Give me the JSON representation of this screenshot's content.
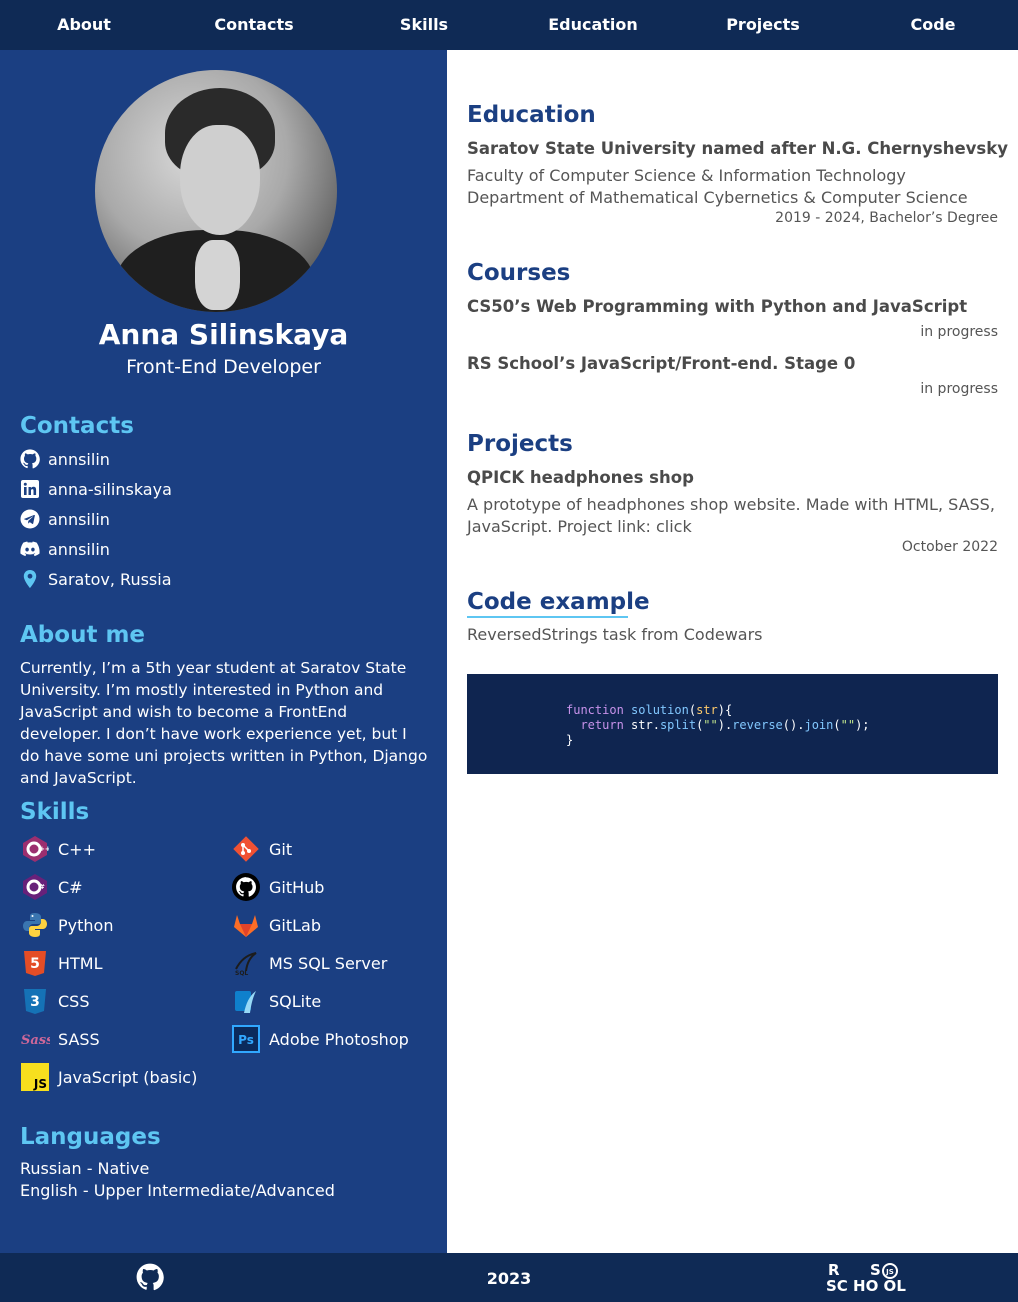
{
  "nav": {
    "items": [
      "About",
      "Contacts",
      "Skills",
      "Education",
      "Projects",
      "Code"
    ]
  },
  "profile": {
    "name": "Anna Silinskaya",
    "role": "Front-End Developer"
  },
  "contacts": {
    "heading": "Contacts",
    "items": [
      {
        "icon": "github-icon",
        "text": "annsilin"
      },
      {
        "icon": "linkedin-icon",
        "text": "anna-silinskaya"
      },
      {
        "icon": "telegram-icon",
        "text": "annsilin"
      },
      {
        "icon": "discord-icon",
        "text": "annsilin"
      },
      {
        "icon": "location-icon",
        "text": "Saratov, Russia"
      }
    ]
  },
  "about": {
    "heading": "About me",
    "text": "Currently, I’m a 5th year student at Saratov State University. I’m mostly interested in Python and JavaScript and wish to become a FrontEnd developer. I don’t have work experience yet, but I do have some uni projects written in Python, Django and JavaScript."
  },
  "skills": {
    "heading": "Skills",
    "items": [
      {
        "icon": "cpp-icon",
        "name": "C++"
      },
      {
        "icon": "git-icon",
        "name": "Git"
      },
      {
        "icon": "csharp-icon",
        "name": "C#"
      },
      {
        "icon": "github-icon",
        "name": "GitHub"
      },
      {
        "icon": "python-icon",
        "name": "Python"
      },
      {
        "icon": "gitlab-icon",
        "name": "GitLab"
      },
      {
        "icon": "html-icon",
        "name": "HTML"
      },
      {
        "icon": "mssql-icon",
        "name": "MS SQL Server"
      },
      {
        "icon": "css-icon",
        "name": "CSS"
      },
      {
        "icon": "sqlite-icon",
        "name": "SQLite"
      },
      {
        "icon": "sass-icon",
        "name": "SASS"
      },
      {
        "icon": "photoshop-icon",
        "name": "Adobe Photoshop"
      },
      {
        "icon": "javascript-icon",
        "name": "JavaScript (basic)"
      }
    ]
  },
  "languages": {
    "heading": "Languages",
    "items": [
      "Russian - Native",
      "English - Upper Intermediate/Advanced"
    ]
  },
  "education": {
    "heading": "Education",
    "university": "Saratov State University named after N.G. Chernyshevsky",
    "faculty": "Faculty of Computer Science & Information Technology",
    "department": "Department of Mathematical Cybernetics & Computer Science",
    "period": "2019 - 2024, Bachelor’s Degree"
  },
  "courses": {
    "heading": "Courses",
    "items": [
      {
        "title": "CS50’s Web Programming with Python and JavaScript",
        "status": "in progress"
      },
      {
        "title": "RS School’s JavaScript/Front-end. Stage 0",
        "status": "in progress"
      }
    ]
  },
  "projects": {
    "heading": "Projects",
    "title": "QPICK headphones shop",
    "description": "A prototype of headphones shop website. Made with HTML, SASS, JavaScript. Project link: click",
    "date": "October 2022"
  },
  "code": {
    "heading": "Code example",
    "subtitle": "ReversedStrings task from Codewars",
    "lines": [
      "function solution(str){",
      "  return str.split(\"\").reverse().join(\"\");",
      "}"
    ]
  },
  "footer": {
    "year": "2023",
    "rs_logo_text": "RS SCHOOL JS"
  }
}
